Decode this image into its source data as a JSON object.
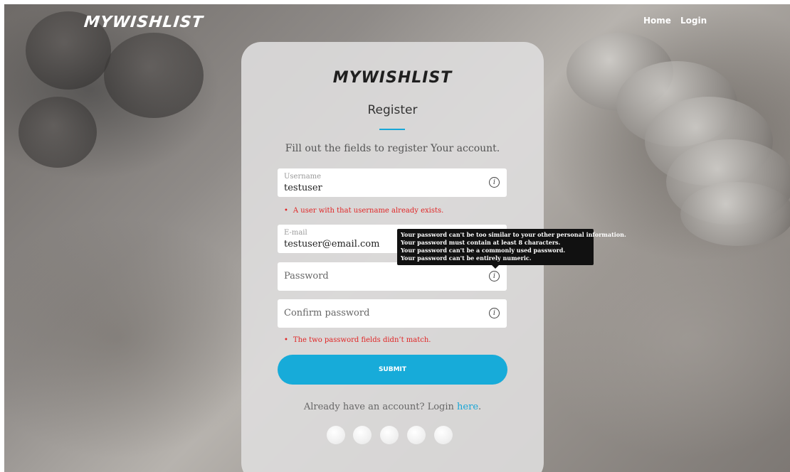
{
  "navbar": {
    "brand": "MYWISHLIST",
    "links": [
      {
        "label": "Home"
      },
      {
        "label": "Login"
      }
    ]
  },
  "card": {
    "brand": "MYWISHLIST",
    "title": "Register",
    "subtitle": "Fill out the fields to register Your account.",
    "fields": {
      "username": {
        "label": "Username",
        "value": "testuser",
        "icon": "info-icon"
      },
      "email": {
        "label": "E-mail",
        "value": "testuser@email.com"
      },
      "password": {
        "placeholder": "Password",
        "icon": "info-icon"
      },
      "confirm_password": {
        "placeholder": "Confirm password",
        "icon": "info-icon"
      }
    },
    "errors": {
      "username": "A user with that username already exists.",
      "password": "The two password fields didn’t match."
    },
    "submit_label": "SUBMIT",
    "login_prompt": "Already have an account? Login ",
    "login_link": "here",
    "login_suffix": "."
  },
  "tooltip": {
    "lines": [
      "Your password can't be too similar to your other personal information.",
      "Your password must contain at least 8 characters.",
      "Your password can't be a commonly used password.",
      "Your password can't be entirely numeric."
    ]
  },
  "colors": {
    "accent": "#17abd9",
    "error": "#e02424",
    "tooltip_bg": "#111111"
  }
}
